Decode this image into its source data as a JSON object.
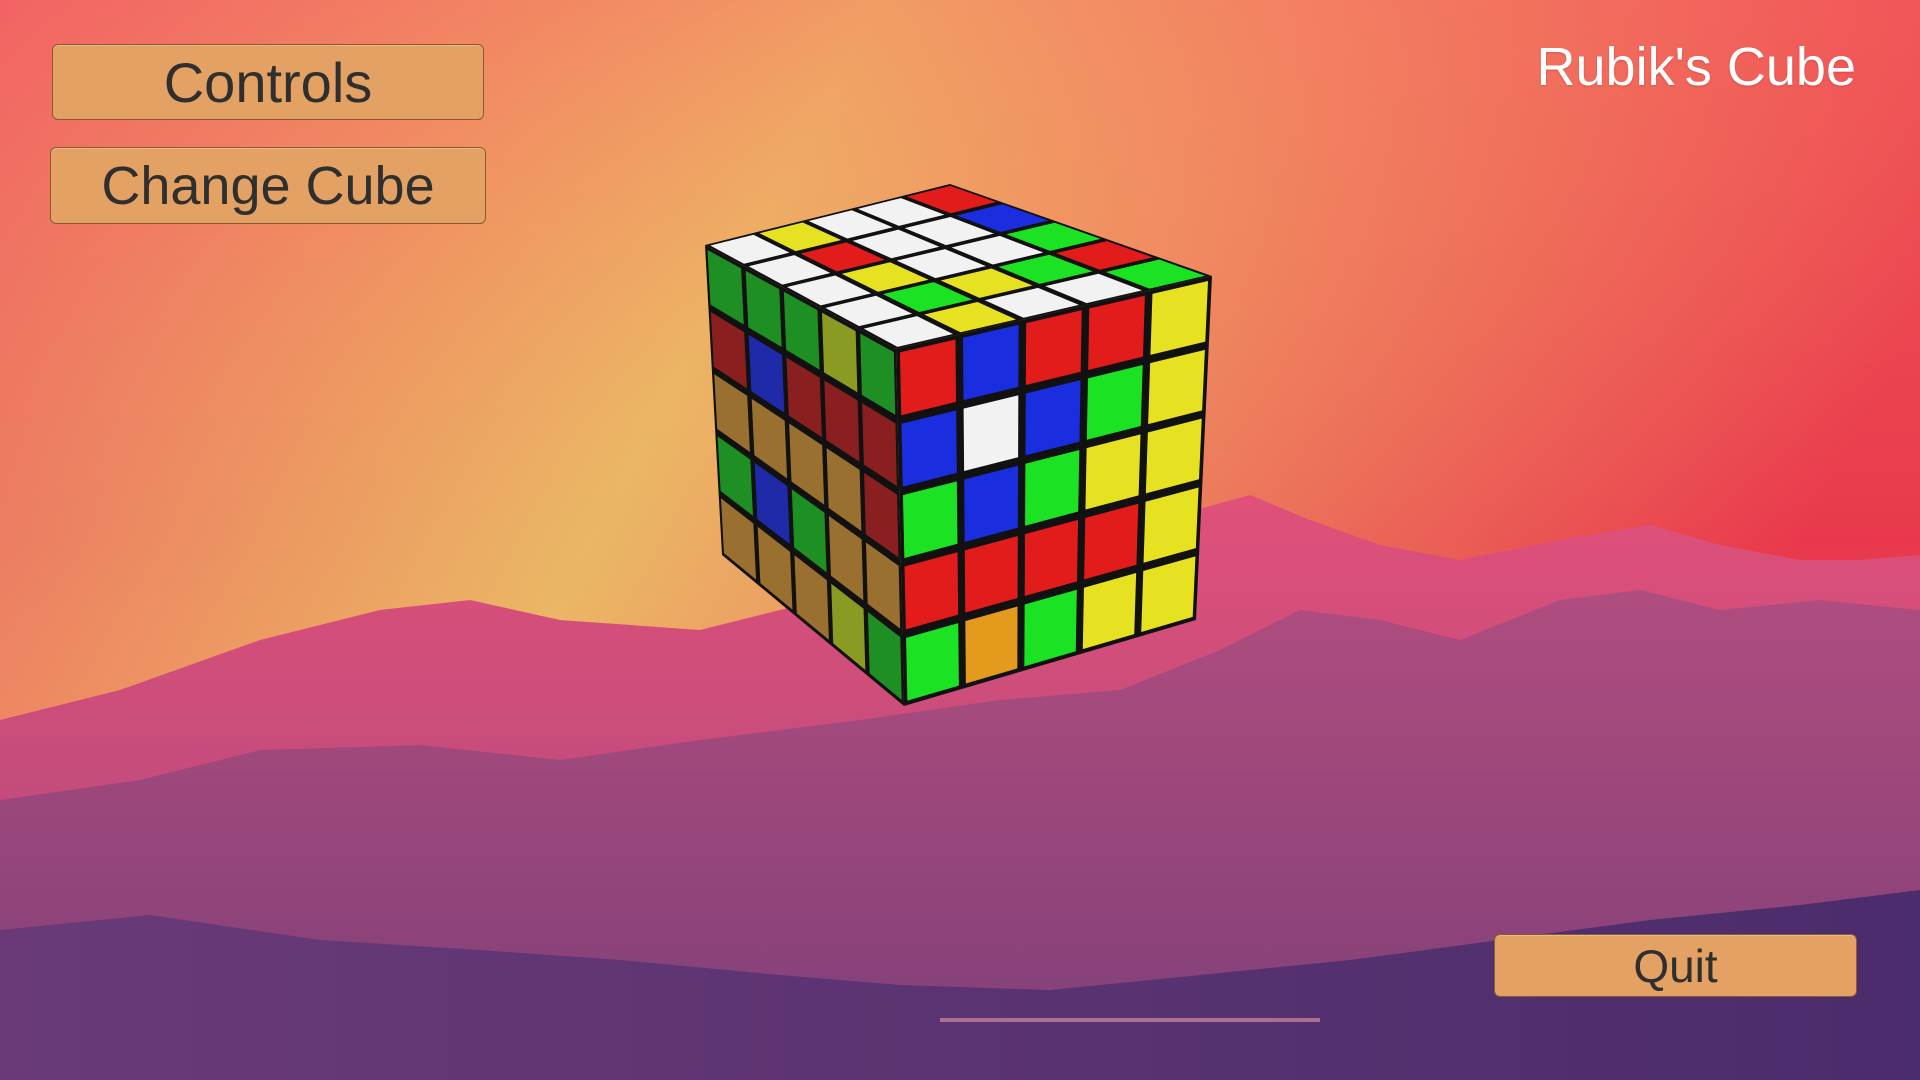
{
  "app": {
    "title": "Rubik's Cube"
  },
  "menu": {
    "controls_label": "Controls",
    "change_cube_label": "Change Cube",
    "quit_label": "Quit"
  },
  "colors": {
    "button_fill": "#e3a163",
    "button_border": "#8a5a30",
    "button_text": "#2f2f2f",
    "title_text": "#ffffff"
  },
  "cube": {
    "size": 5,
    "palette": {
      "W": "#f2f2f2",
      "Y": "#e6e221",
      "R": "#e21b1b",
      "G": "#1be222",
      "B": "#1a2ee0",
      "O": "#e49a1c",
      "DR": "#8a1f1f",
      "DB": "#1f2aa8",
      "DG": "#1e8f22",
      "BR": "#9a7030",
      "OL": "#8a9a22"
    },
    "top_face": [
      [
        "W",
        "Y",
        "W",
        "W",
        "R"
      ],
      [
        "W",
        "R",
        "W",
        "W",
        "B"
      ],
      [
        "W",
        "Y",
        "W",
        "W",
        "G"
      ],
      [
        "W",
        "G",
        "Y",
        "G",
        "R"
      ],
      [
        "W",
        "Y",
        "W",
        "W",
        "G"
      ]
    ],
    "front_face": [
      [
        "R",
        "B",
        "R",
        "R",
        "Y"
      ],
      [
        "B",
        "W",
        "B",
        "G",
        "Y"
      ],
      [
        "G",
        "B",
        "G",
        "Y",
        "Y"
      ],
      [
        "R",
        "R",
        "R",
        "R",
        "Y"
      ],
      [
        "G",
        "O",
        "G",
        "Y",
        "Y"
      ]
    ],
    "left_face": [
      [
        "DG",
        "DG",
        "DG",
        "OL",
        "DG"
      ],
      [
        "DR",
        "DB",
        "DR",
        "DR",
        "DR"
      ],
      [
        "BR",
        "BR",
        "BR",
        "BR",
        "DR"
      ],
      [
        "DG",
        "DB",
        "DG",
        "BR",
        "BR"
      ],
      [
        "BR",
        "BR",
        "BR",
        "OL",
        "DG"
      ]
    ]
  }
}
